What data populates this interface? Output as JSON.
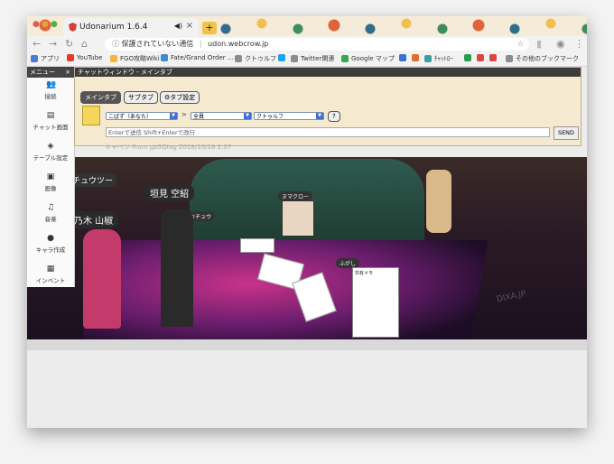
{
  "browser": {
    "tab_title": "Udonarium 1.6.4",
    "new_tab": "+",
    "url_security": "保護されていない通信",
    "url_separator": "|",
    "url": "udon.webcrow.jp",
    "bookmarks": [
      {
        "label": "アプリ",
        "color": "#4a7bd8"
      },
      {
        "label": "YouTube",
        "color": "#e23c2e"
      },
      {
        "label": "FGO攻略Wiki",
        "color": "#f0b83a"
      },
      {
        "label": "Fate/Grand Order ...",
        "color": "#3a8bd0"
      },
      {
        "label": "クトゥルフ",
        "color": "#8c8c8c"
      },
      {
        "label": "",
        "color": "#1da1f2"
      },
      {
        "label": "Twitter関連",
        "color": "#8c8c8c"
      },
      {
        "label": "Google マップ",
        "color": "#34a853"
      },
      {
        "label": "",
        "color": "#3a6fd0"
      },
      {
        "label": "",
        "color": "#e36b2b"
      },
      {
        "label": "ﾁｬｯﾄﾛｰ",
        "color": "#3aa0a0"
      },
      {
        "label": "",
        "color": "#2a9d4a"
      },
      {
        "label": "",
        "color": "#d44"
      },
      {
        "label": "",
        "color": "#d44"
      },
      {
        "label": "その他のブックマーク",
        "color": "#8c8c8c"
      }
    ]
  },
  "menu": {
    "title": "メニュー",
    "close": "×",
    "items": [
      {
        "label": "接続",
        "icon": "people-icon"
      },
      {
        "label": "チャット画面",
        "icon": "chat-icon"
      },
      {
        "label": "テーブル設定",
        "icon": "layers-icon"
      },
      {
        "label": "画像",
        "icon": "image-icon"
      },
      {
        "label": "音楽",
        "icon": "music-icon"
      },
      {
        "label": "キャラ作成",
        "icon": "character-icon"
      },
      {
        "label": "インベント",
        "icon": "inventory-icon"
      }
    ]
  },
  "chat": {
    "title": "チャットウィンドウ - メインタブ",
    "tabs": [
      "メインタブ",
      "サブタブ",
      "タブ設定"
    ],
    "sender_select": "こばず（あなた）",
    "arrow": ">",
    "target_select": "全員",
    "system_select": "クトゥルフ",
    "help": "?",
    "input_placeholder": "Enterで送信  Shift+Enterで改行",
    "send": "SEND",
    "prev_message": "キャベツ   From gb5Qfag   2018/10/16 2:07"
  },
  "scene": {
    "labels": [
      "チュウツー",
      "垣見 空紹",
      "乃木 山椒",
      "ヌマクロー",
      "ふがし",
      "カチュウ"
    ],
    "memo_title": "共有メモ",
    "floor_text": "DIXA.JP"
  }
}
